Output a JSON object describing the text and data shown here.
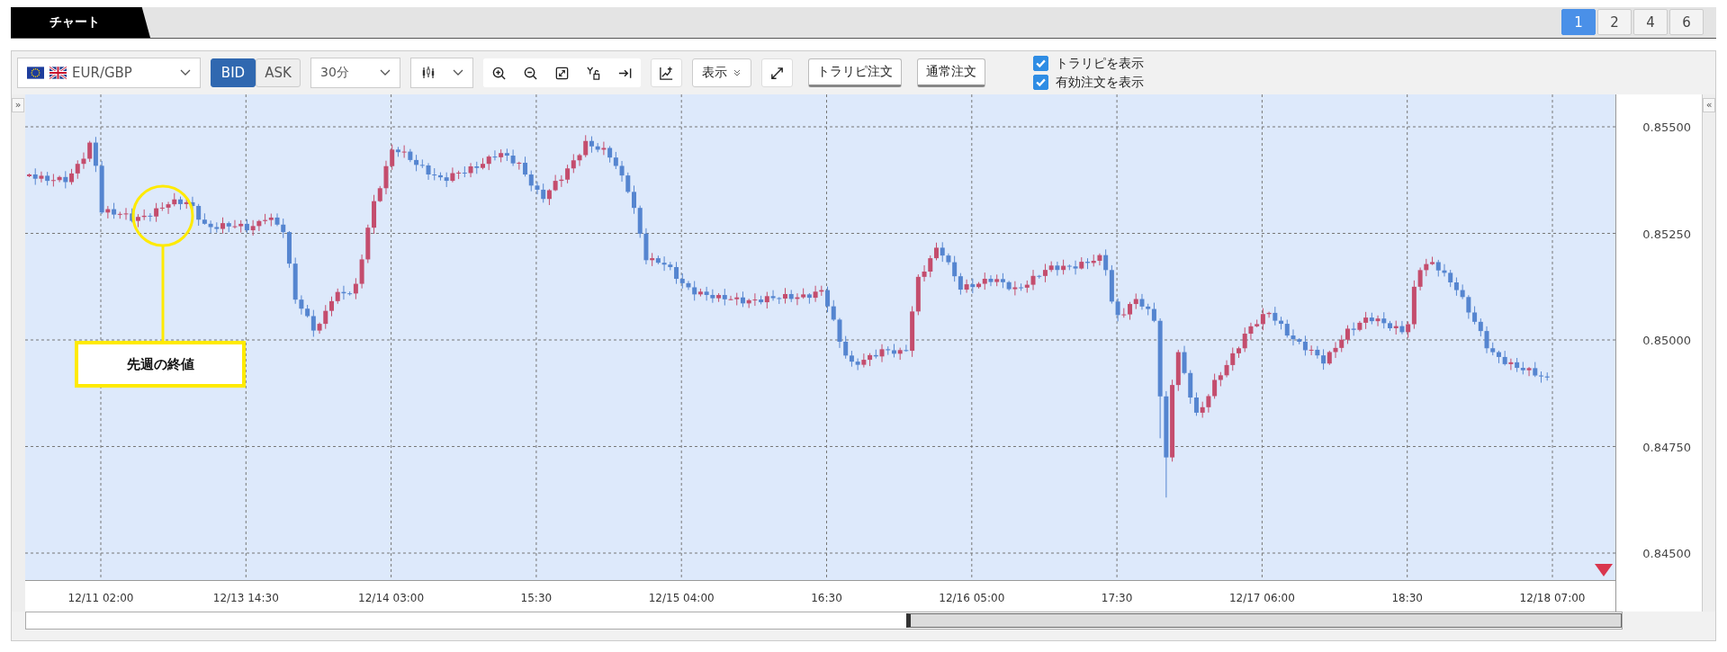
{
  "tabs": [
    {
      "label": "チャート",
      "selected": true
    }
  ],
  "layout_buttons": [
    {
      "label": "1",
      "selected": true
    },
    {
      "label": "2",
      "selected": false
    },
    {
      "label": "4",
      "selected": false
    },
    {
      "label": "6",
      "selected": false
    }
  ],
  "toolbar": {
    "symbol": "EUR/GBP",
    "price_sides": [
      {
        "label": "BID",
        "selected": true
      },
      {
        "label": "ASK",
        "selected": false
      }
    ],
    "interval": "30分",
    "display_menu": "表示",
    "order_buttons": [
      "トラリピ注文",
      "通常注文"
    ],
    "options": [
      {
        "label": "トラリピを表示",
        "checked": true
      },
      {
        "label": "有効注文を表示",
        "checked": true
      }
    ]
  },
  "chart": {
    "expand_left": "»",
    "expand_right": "«",
    "y_labels": [
      "0.85500",
      "0.85250",
      "0.85000",
      "0.84750",
      "0.84500"
    ],
    "x_labels": [
      "12/11 02:00",
      "12/13 14:30",
      "12/14 03:00",
      "15:30",
      "12/15 04:00",
      "16:30",
      "12/16 05:00",
      "17:30",
      "12/17 06:00",
      "18:30",
      "12/18 07:00"
    ],
    "annotation": "先週の終値"
  }
}
